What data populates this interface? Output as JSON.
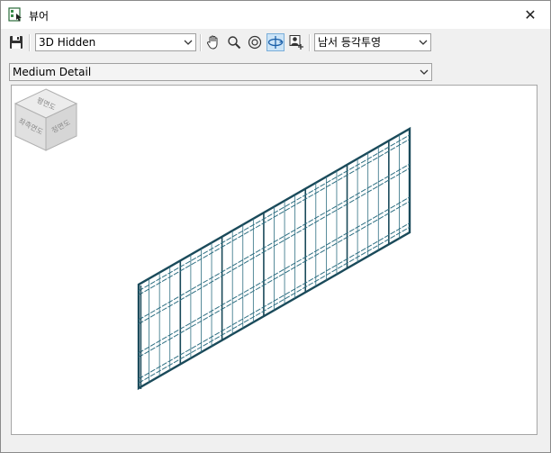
{
  "window": {
    "title": "뷰어",
    "close_label": "✕"
  },
  "toolbar": {
    "visual_style": "3D Hidden",
    "view_preset": "남서 등각투영",
    "detail_level": "Medium Detail"
  },
  "viewcube": {
    "top_face": "평면도",
    "left_face": "좌측면도",
    "right_face": "정면도"
  },
  "colors": {
    "panel_edge": "#1a4a5a",
    "panel_line": "#2e6f82",
    "viewport_bg": "#ffffff",
    "cube_face": "#e4e4e4"
  }
}
